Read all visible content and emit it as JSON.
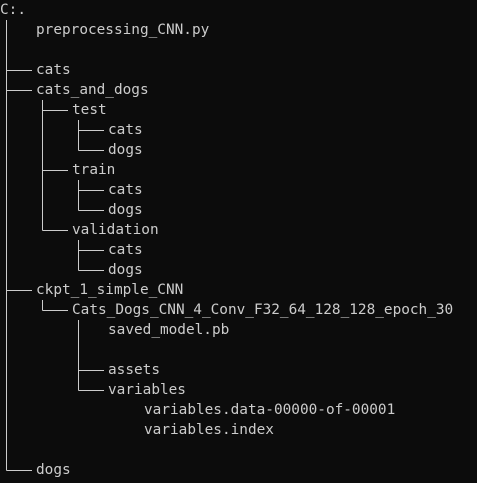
{
  "terminal": {
    "root_label": "C:.",
    "entries": {
      "preprocessing_file": "preprocessing_CNN.py",
      "cats": "cats",
      "cats_and_dogs": "cats_and_dogs",
      "test": "test",
      "test_cats": "cats",
      "test_dogs": "dogs",
      "train": "train",
      "train_cats": "cats",
      "train_dogs": "dogs",
      "validation": "validation",
      "validation_cats": "cats",
      "validation_dogs": "dogs",
      "ckpt": "ckpt_1_simple_CNN",
      "model_dir": "Cats_Dogs_CNN_4_Conv_F32_64_128_128_epoch_30",
      "saved_model": "saved_model.pb",
      "assets": "assets",
      "variables": "variables",
      "variables_data": "variables.data-00000-of-00001",
      "variables_index": "variables.index",
      "dogs": "dogs"
    }
  },
  "colors": {
    "background": "#0c0c0c",
    "foreground": "#cccccc"
  }
}
